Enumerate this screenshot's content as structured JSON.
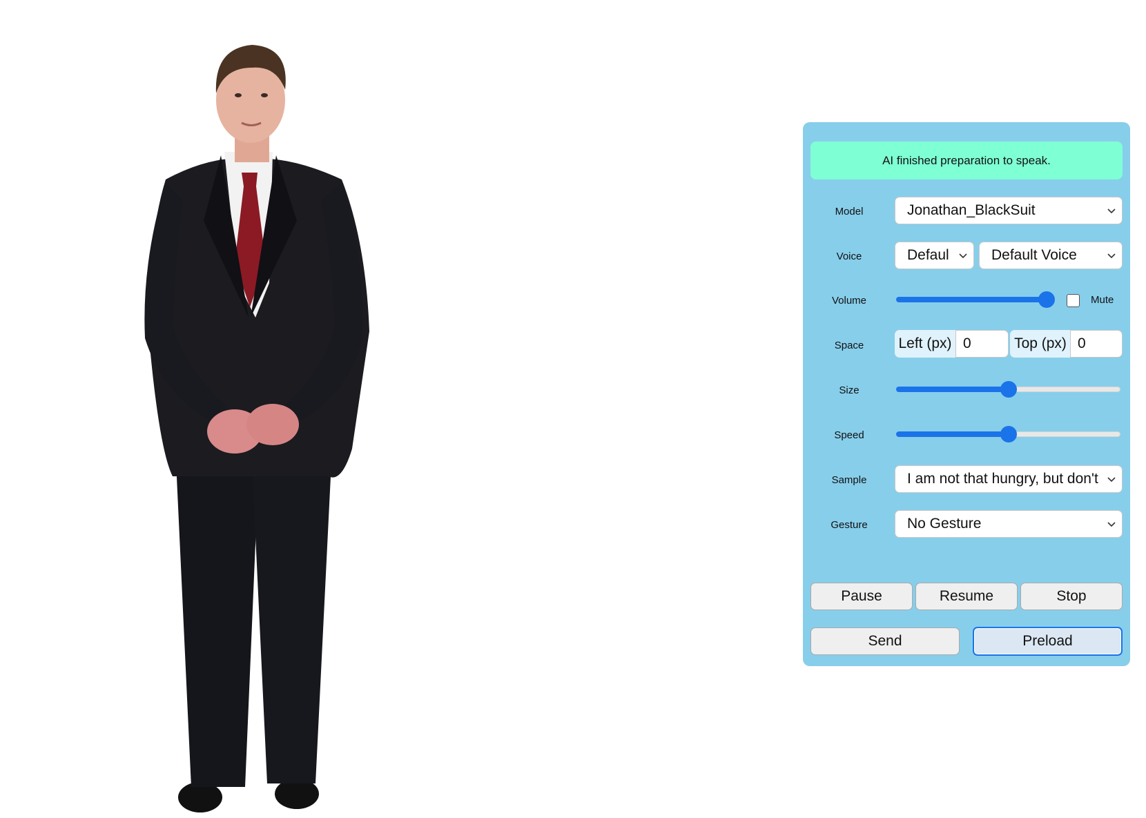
{
  "status": "AI finished preparation to speak.",
  "labels": {
    "model": "Model",
    "voice": "Voice",
    "volume": "Volume",
    "space": "Space",
    "size": "Size",
    "speed": "Speed",
    "sample": "Sample",
    "gesture": "Gesture"
  },
  "model": {
    "selected": "Jonathan_BlackSuit"
  },
  "voice": {
    "language_selected": "Defaul",
    "voice_selected": "Default Voice"
  },
  "volume": {
    "level": 1.0,
    "mute_label": "Mute",
    "muted": false
  },
  "space": {
    "left_label": "Left  (px)",
    "left_value": "0",
    "top_label": "Top  (px)",
    "top_value": "0"
  },
  "size": {
    "level": 0.5
  },
  "speed": {
    "level": 0.5
  },
  "sample": {
    "selected": "I am not that hungry, but don't"
  },
  "gesture": {
    "selected": "No Gesture"
  },
  "buttons": {
    "pause": "Pause",
    "resume": "Resume",
    "stop": "Stop",
    "send": "Send",
    "preload": "Preload"
  },
  "colors": {
    "panel_bg": "#87ceeb",
    "status_bg": "#7fffd4",
    "accent": "#1a73e8"
  },
  "icons": {
    "select_arrow": "chevron-down-icon"
  }
}
